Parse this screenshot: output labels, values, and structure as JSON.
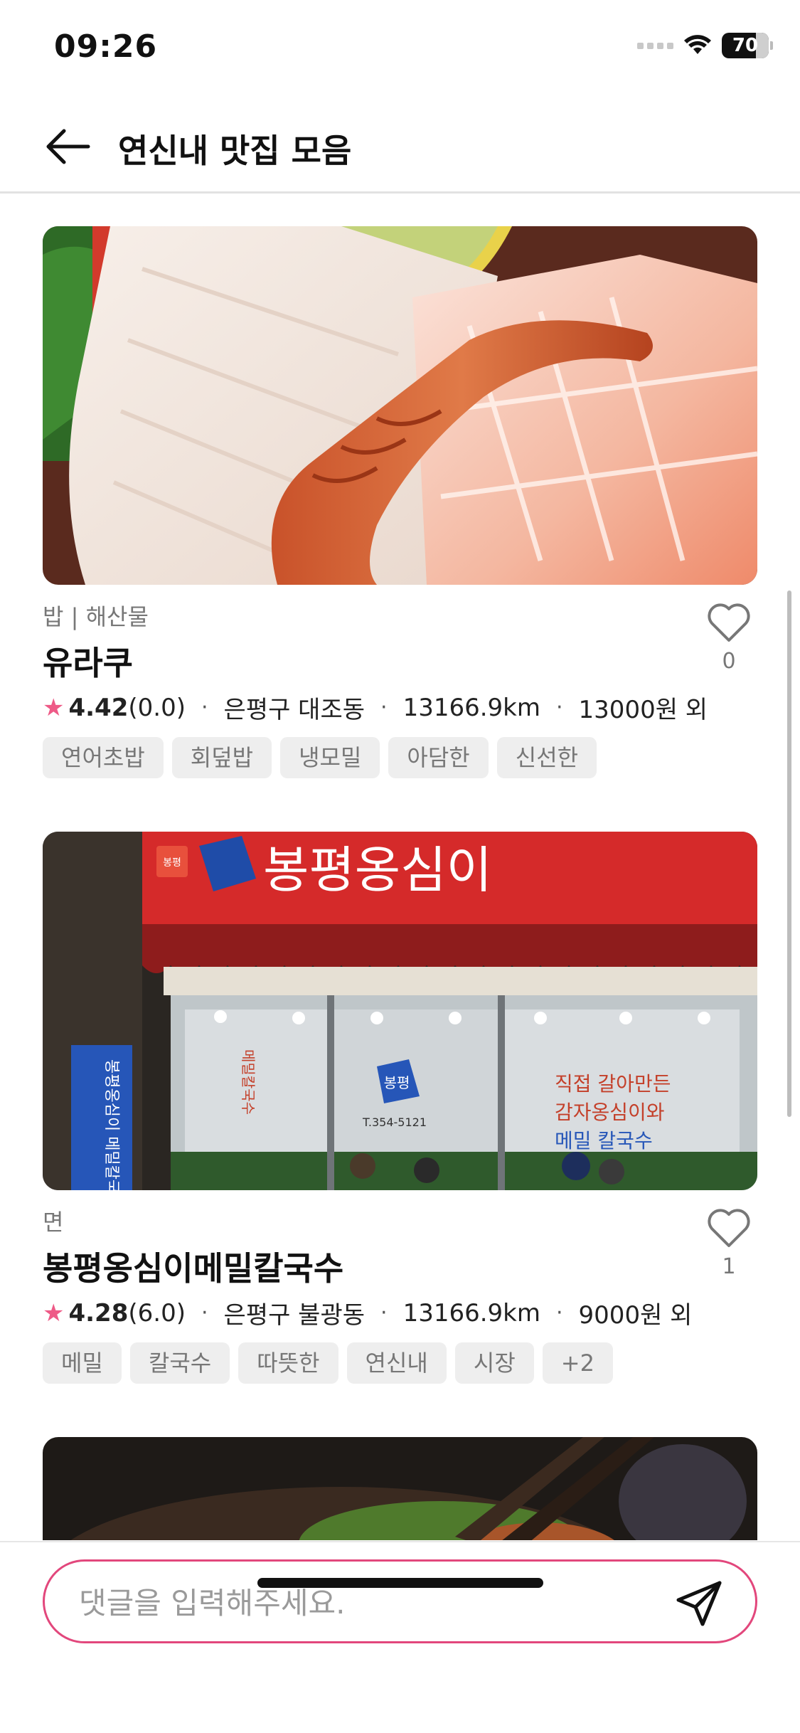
{
  "status_bar": {
    "time": "09:26",
    "battery": "70"
  },
  "header": {
    "title": "연신내 맛집 모음"
  },
  "restaurants": [
    {
      "category": "밥 | 해산물",
      "name": "유라쿠",
      "rating": "4.42",
      "review_count": "(0.0)",
      "location": "은평구 대조동",
      "distance": "13166.9km",
      "price": "13000원 외",
      "like_count": "0",
      "tags": [
        "연어초밥",
        "회덮밥",
        "냉모밀",
        "아담한",
        "신선한"
      ]
    },
    {
      "category": "면",
      "name": "봉평옹심이메밀칼국수",
      "rating": "4.28",
      "review_count": "(6.0)",
      "location": "은평구 불광동",
      "distance": "13166.9km",
      "price": "9000원 외",
      "like_count": "1",
      "tags": [
        "메밀",
        "칼국수",
        "따뜻한",
        "연신내",
        "시장",
        "+2"
      ],
      "photo_text": {
        "sign_small": "봉평",
        "sign_large": "봉평옹심이",
        "banner": "봉평옹심이 메밀칼국수",
        "window_left": "메밀칼국수",
        "window_logo": "봉평",
        "window_phone": "T.354-5121",
        "window_right": [
          "직접 갈아만든",
          "감자옹심이와",
          "메밀 칼국수"
        ]
      }
    }
  ],
  "comment": {
    "placeholder": "댓글을 입력해주세요."
  },
  "colors": {
    "accent": "#e2477c",
    "star": "#ee5a87",
    "tag_bg": "#eeeeee"
  }
}
